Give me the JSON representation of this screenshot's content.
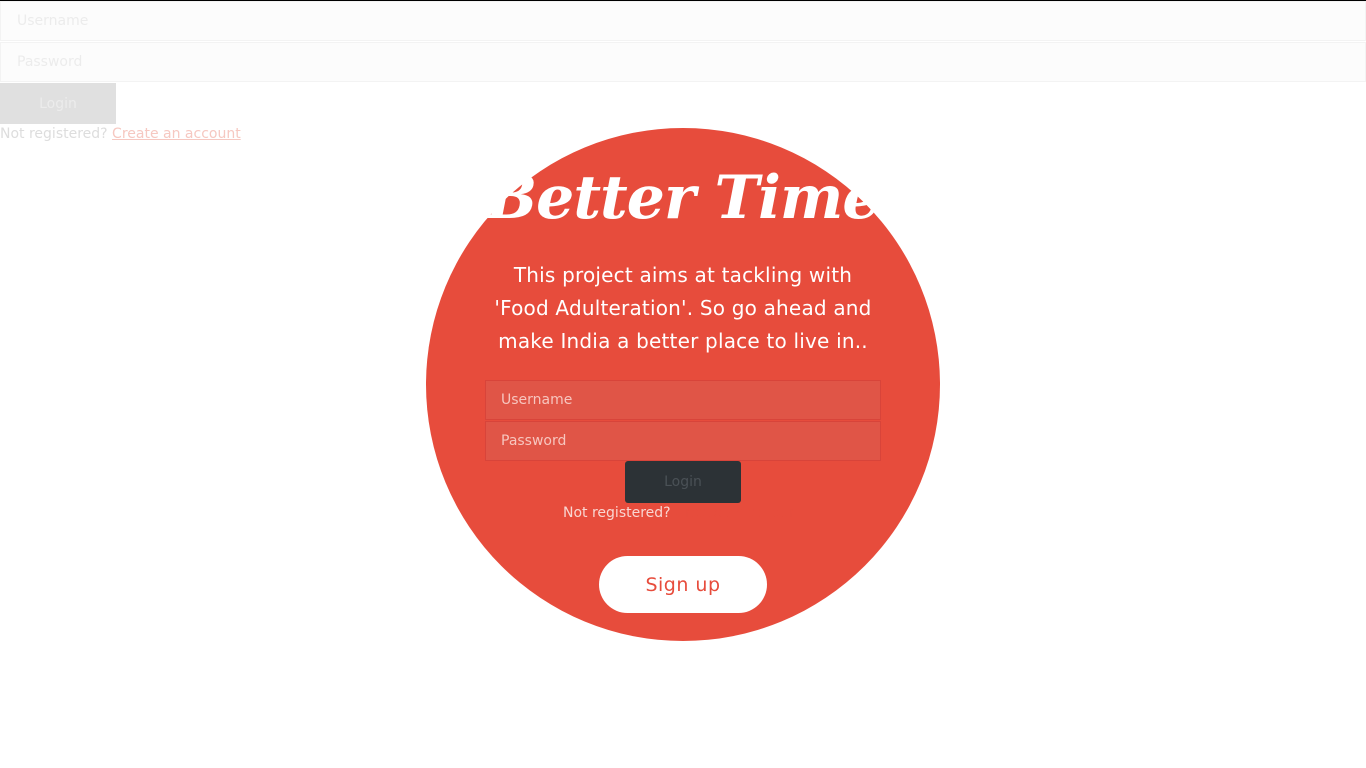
{
  "background_form": {
    "username_placeholder": "Username",
    "password_placeholder": "Password",
    "login_label": "Login",
    "not_registered": "Not registered?",
    "create_account_link": "Create an account"
  },
  "card": {
    "brand": "Better Time",
    "tagline": "This project aims at tackling with 'Food Adulteration'. So go ahead and make India a better place to live in..",
    "username_placeholder": "Username",
    "password_placeholder": "Password",
    "login_label": "Login",
    "not_registered": "Not registered?",
    "create_account_link": "Create an account",
    "signup_label": "Sign up"
  },
  "colors": {
    "accent": "#e74c3c",
    "login_button": "#2c3236",
    "signup_button": "#ffffff"
  }
}
